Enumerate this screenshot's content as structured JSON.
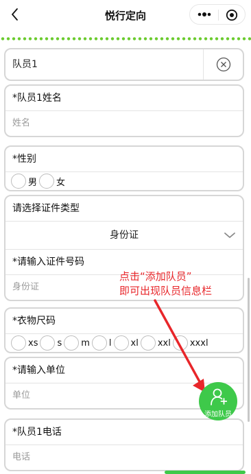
{
  "nav": {
    "back_icon": "chevron-left-icon",
    "title": "悦行定向",
    "more_icon": "more-dots-icon",
    "target_icon": "target-icon"
  },
  "member": {
    "name": "队员1",
    "clear_icon": "clear-circle-icon"
  },
  "name_field": {
    "label": "*队员1姓名",
    "placeholder": "姓名"
  },
  "gender": {
    "label": "*性别",
    "options": [
      "男",
      "女"
    ]
  },
  "id_type": {
    "label": "请选择证件类型",
    "value": "身份证",
    "chevron_icon": "chevron-down-icon"
  },
  "id_number": {
    "label": "*请输入证件号码",
    "placeholder": "身份证"
  },
  "annotation": {
    "line1": "点击“添加队员”",
    "line2": "即可出现队员信息栏",
    "color": "#e8262a"
  },
  "clothing": {
    "label": "*衣物尺码",
    "options": [
      "xs",
      "s",
      "m",
      "l",
      "xl",
      "xxl",
      "xxxl"
    ]
  },
  "unit": {
    "label": "*请输入单位",
    "placeholder": "单位"
  },
  "phone": {
    "label": "*队员1电话",
    "placeholder": "电话"
  },
  "fab": {
    "label": "添加队员",
    "icon": "add-user-icon",
    "color": "#3ec94a"
  },
  "accent": "#6bcb2e"
}
